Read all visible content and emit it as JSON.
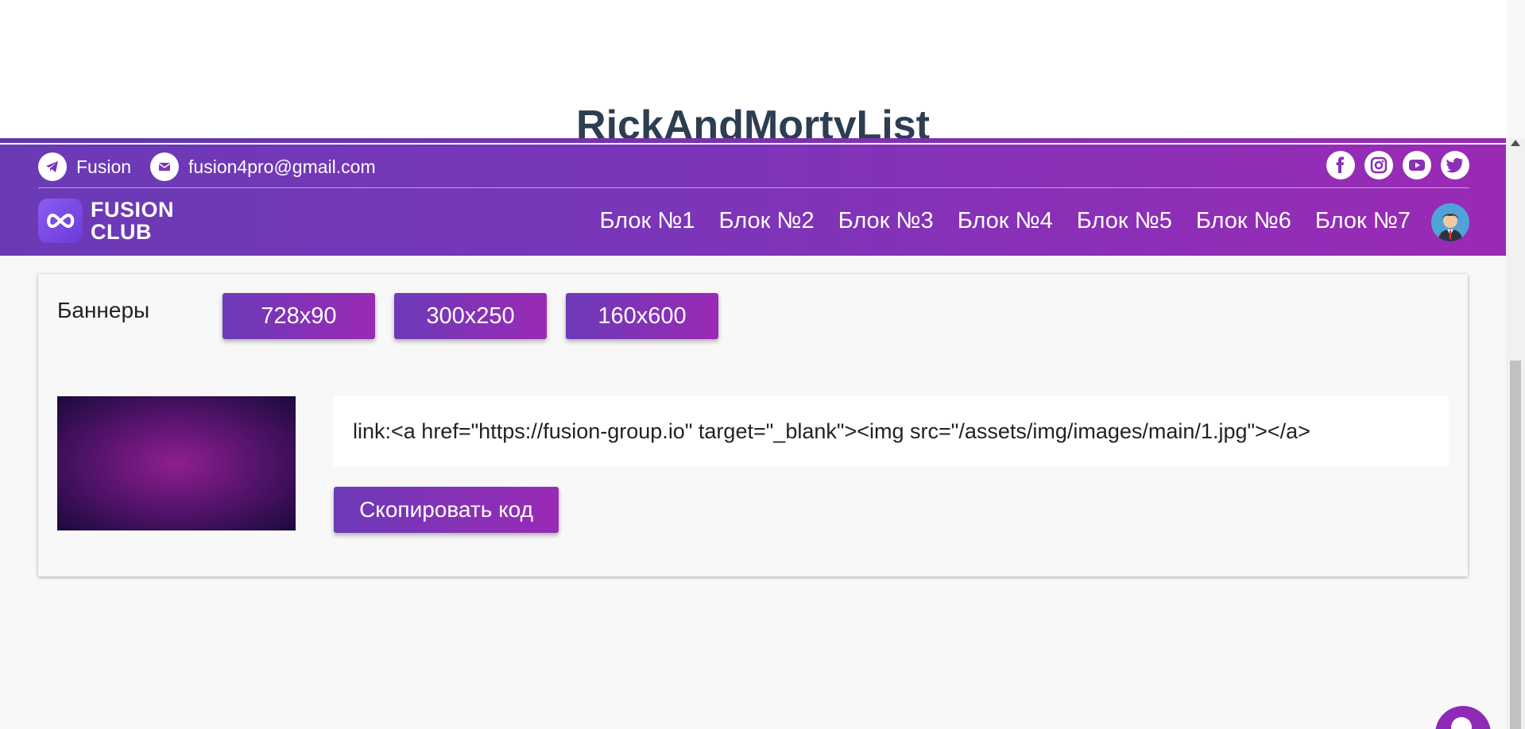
{
  "app": {
    "title": "RickAndMortyList"
  },
  "header": {
    "contacts": {
      "telegram_label": "Fusion",
      "email_label": "fusion4pro@gmail.com"
    },
    "logo": {
      "line1": "FUSION",
      "line2": "CLUB"
    },
    "nav": [
      "Блок №1",
      "Блок №2",
      "Блок №3",
      "Блок №4",
      "Блок №5",
      "Блок №6",
      "Блок №7"
    ],
    "socials": [
      "facebook-icon",
      "instagram-icon",
      "youtube-icon",
      "twitter-icon"
    ]
  },
  "banners": {
    "label": "Баннеры",
    "sizes": [
      "728x90",
      "300x250",
      "160x600"
    ],
    "code": "link:<a href=\"https://fusion-group.io\" target=\"_blank\"><img src=\"/assets/img/images/main/1.jpg\"></a>",
    "copy_label": "Скопировать код"
  },
  "colors": {
    "gradient_start": "#6a3ab5",
    "gradient_end": "#9a2ab5",
    "title_text": "#2c3e50"
  }
}
